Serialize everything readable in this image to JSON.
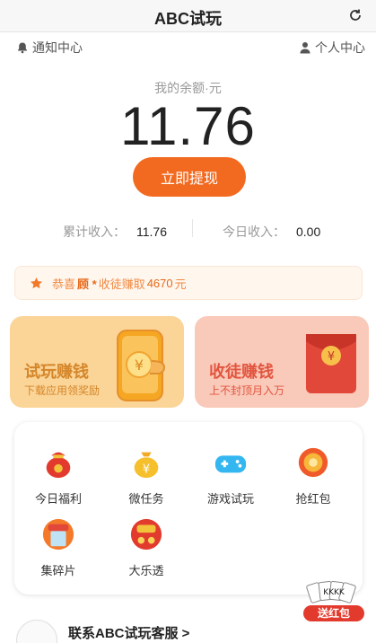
{
  "header": {
    "title": "ABC试玩",
    "refresh_icon": "refresh-icon"
  },
  "nav": {
    "notify_label": "通知中心",
    "profile_label": "个人中心"
  },
  "balance": {
    "label": "我的余额·元",
    "value": "11.76",
    "withdraw_label": "立即提现"
  },
  "income": {
    "total_label": "累计收入：",
    "total_value": "11.76",
    "today_label": "今日收入：",
    "today_value": "0.00"
  },
  "notice": {
    "prefix": "恭喜",
    "name": "顾 *",
    "middle": "收徒赚取",
    "amount": "4670",
    "suffix": "元"
  },
  "cards": {
    "try": {
      "title": "试玩赚钱",
      "subtitle": "下载应用领奖励"
    },
    "apprentice": {
      "title": "收徒赚钱",
      "subtitle": "上不封顶月入万"
    }
  },
  "features": [
    {
      "label": "今日福利",
      "icon": "lucky-bag-icon",
      "badge": "铁\n疯\n我"
    },
    {
      "label": "微任务",
      "icon": "money-bag-icon"
    },
    {
      "label": "游戏试玩",
      "icon": "gamepad-icon"
    },
    {
      "label": "抢红包",
      "icon": "coin-icon"
    },
    {
      "label": "集碎片",
      "icon": "phone-gift-icon",
      "badge": "送手机"
    },
    {
      "label": "大乐透",
      "icon": "lottery-icon",
      "badge": "乐透"
    }
  ],
  "floating": {
    "label": "送红包",
    "cards_text": "KKKK"
  },
  "service": {
    "label": "联系ABC试玩客服 >"
  },
  "colors": {
    "accent": "#f26a20",
    "try_card": "#fbd497",
    "app_card": "#f9c9b9"
  }
}
